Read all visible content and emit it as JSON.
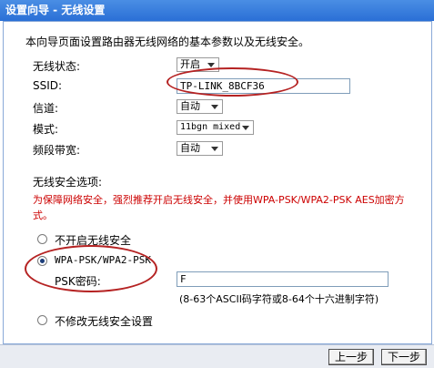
{
  "window": {
    "title": "设置向导 - 无线设置"
  },
  "intro": "本向导页面设置路由器无线网络的基本参数以及无线安全。",
  "form": {
    "wireless_status_label": "无线状态:",
    "wireless_status_value": "开启",
    "ssid_label": "SSID:",
    "ssid_value": "TP-LINK_8BCF36",
    "channel_label": "信道:",
    "channel_value": "自动",
    "mode_label": "模式:",
    "mode_value": "11bgn mixed",
    "bandwidth_label": "频段带宽:",
    "bandwidth_value": "自动"
  },
  "security": {
    "heading": "无线安全选项:",
    "warning_line1": "为保障网络安全，强烈推荐开启无线安全，并使用WPA-PSK/WPA2-PSK AES加密方",
    "warning_line2": "式。",
    "option_none": "不开启无线安全",
    "option_wpa": "WPA-PSK/WPA2-PSK",
    "psk_label": "PSK密码:",
    "psk_value": "F",
    "psk_hint": "(8-63个ASCII码字符或8-64个十六进制字符)",
    "option_keep": "不修改无线安全设置",
    "selected_option": "WPA-PSK/WPA2-PSK"
  },
  "buttons": {
    "prev": "上一步",
    "next": "下一步"
  },
  "colors": {
    "warning": "#cc0000",
    "annotation": "#b52222",
    "titlebar": "#2a6fd6"
  }
}
